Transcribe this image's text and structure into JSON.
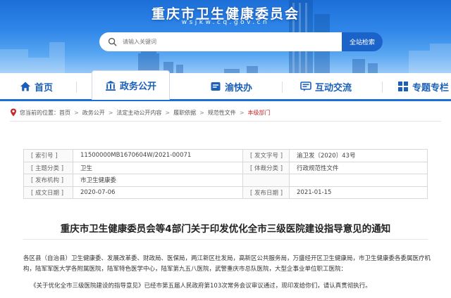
{
  "header": {
    "site_title": "重庆市卫生健康委员会",
    "site_domain": "wsjkw.cq.gov.cn",
    "search_placeholder": "请输入关键词",
    "search_button": "全站检索"
  },
  "nav": {
    "items": [
      {
        "label": "首页",
        "icon": "home-icon"
      },
      {
        "label": "政务公开",
        "icon": "government-building-icon",
        "active": true
      },
      {
        "label": "渝快办",
        "icon": "service-icon"
      },
      {
        "label": "互动交流",
        "icon": "chat-window-icon"
      },
      {
        "label": "专题专栏",
        "icon": "grid-icon"
      }
    ]
  },
  "breadcrumb": {
    "prefix": "您当前的位置：",
    "items": [
      "首页",
      "政务公开",
      "法定主动公开内容",
      "履职依据",
      "规范性文件"
    ],
    "current": "本级部门",
    "separator": ">"
  },
  "meta": {
    "rows": [
      {
        "k1": "[ 索引号 ]",
        "v1": "11500000MB1670604W/2021-00071",
        "k2": "[ 发文字号 ]",
        "v2": "渝卫发〔2020〕43号"
      },
      {
        "k1": "[ 主题分类 ]",
        "v1": "卫生",
        "k2": "[ 体裁分类 ]",
        "v2": "行政规范性文件"
      },
      {
        "k1": "[ 发布机构 ]",
        "v1": "市卫生健康委",
        "k2": "",
        "v2": ""
      },
      {
        "k1": "[ 成文日期 ]",
        "v1": "2020-07-06",
        "k2": "[ 发布日期 ]",
        "v2": "2021-01-15"
      }
    ]
  },
  "article": {
    "title": "重庆市卫生健康委员会等4部门关于印发优化全市三级医院建设指导意见的通知",
    "paragraph1": "各区县（自治县）卫生健康委、发展改革委、财政局、医保局，两江新区社发局，高新区公共服务局，万盛经开区卫生健康局，市卫生健康委各委属医疗机构，陆军军医大学各附属医院，陆军特色医学中心，陆军第九五八医院，武警重庆市总队医院，大型企事业单位职工医院：",
    "paragraph2": "《关于优化全市三级医院建设的指导意见》已经市第五届人民政府第103次常务会议审议通过，现印发给你们，请认真贯彻执行。"
  },
  "colors": {
    "brand_blue": "#1d6fd8",
    "nav_text": "#1a5fb8",
    "breadcrumb_current": "#c8282c"
  }
}
